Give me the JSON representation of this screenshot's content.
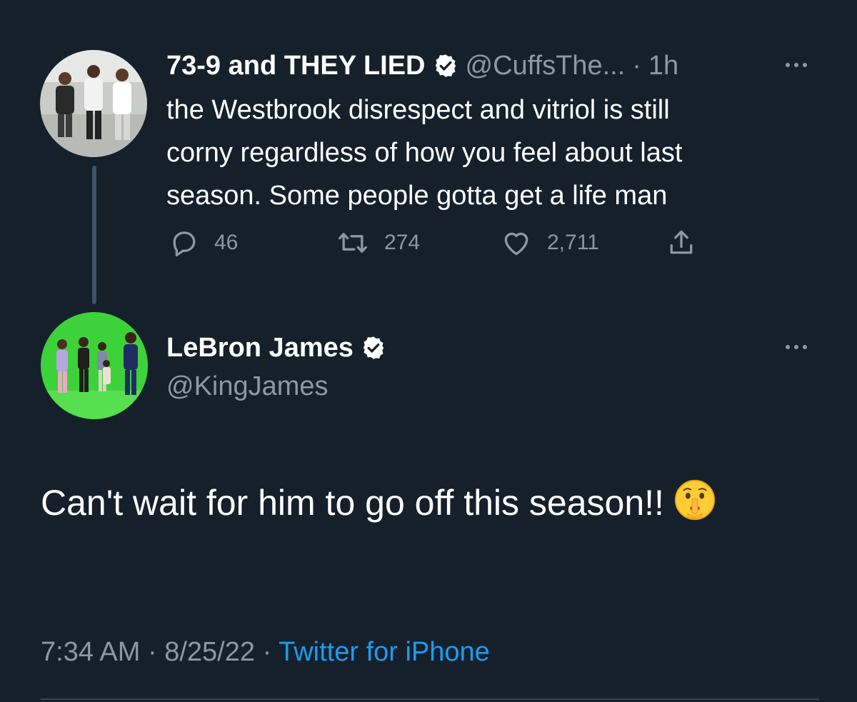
{
  "colors": {
    "background": "#15202b",
    "secondary_text": "#8b98a5",
    "link": "#1d9bf0",
    "thread_line": "#3d5466"
  },
  "parent_tweet": {
    "display_name": "73-9 and THEY LIED",
    "handle": "@CuffsThe...",
    "separator": "·",
    "time_ago": "1h",
    "verified_icon": "verified-badge-icon",
    "text": "the Westbrook disrespect and vitriol is still\ncorny regardless of how you feel about last\nseason. Some people gotta get a life man",
    "actions": {
      "replies": "46",
      "retweets": "274",
      "likes": "2,711"
    }
  },
  "main_tweet": {
    "display_name": "LeBron James",
    "handle": "@KingJames",
    "verified_icon": "verified-badge-icon",
    "text": "Can't wait for him to go off this season!!",
    "emoji": "shushing-face-emoji",
    "time": "7:34 AM",
    "sep1": "·",
    "date": "8/25/22",
    "sep2": "·",
    "source": "Twitter for iPhone"
  }
}
